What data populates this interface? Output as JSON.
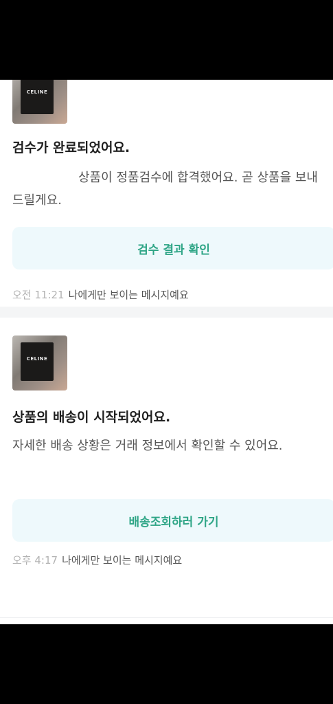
{
  "messages": [
    {
      "thumbnail_logo": "CELINE",
      "title": "검수가 완료되었어요.",
      "body": "상품이 정품검수에 합격했어요. 곧 상품을 보내드릴게요.",
      "cta_label": "검수 결과 확인",
      "time": "오전 11:21",
      "visibility_note": "나에게만 보이는 메시지예요"
    },
    {
      "thumbnail_logo": "CELINE",
      "title": "상품의 배송이 시작되었어요.",
      "body": "자세한 배송 상황은 거래 정보에서 확인할 수 있어요.",
      "cta_label": "배송조회하러 가기",
      "time": "오후 4:17",
      "visibility_note": "나에게만 보이는 메시지예요"
    }
  ],
  "colors": {
    "cta_background": "#eef9fc",
    "cta_text": "#2ea586",
    "time_text": "#b3b3b3"
  }
}
